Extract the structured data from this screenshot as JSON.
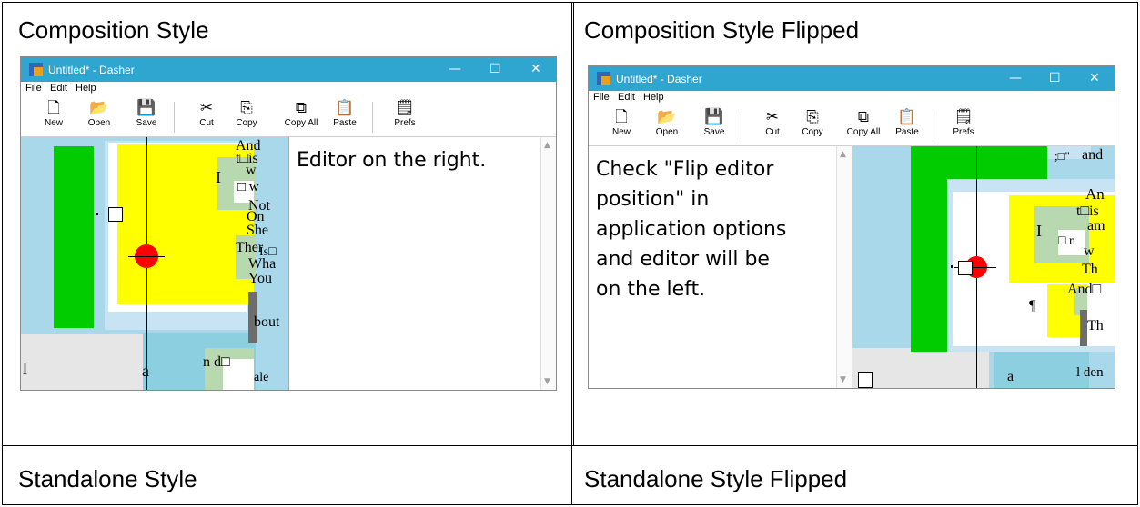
{
  "cells": {
    "top_left_title": "Composition Style",
    "top_right_title": "Composition Style Flipped",
    "bottom_left_title": "Standalone Style",
    "bottom_right_title": "Standalone Style Flipped"
  },
  "window": {
    "title": "Untitled* - Dasher",
    "minimize_glyph": "—",
    "maximize_glyph": "☐",
    "close_glyph": "✕"
  },
  "menu": [
    "File",
    "Edit",
    "Help"
  ],
  "toolbar": {
    "new_label": "New",
    "open_label": "Open",
    "save_label": "Save",
    "cut_label": "Cut",
    "copy_label": "Copy",
    "copy_all_label": "Copy All",
    "paste_label": "Paste",
    "prefs_label": "Prefs"
  },
  "icons": {
    "new": "new-file-icon",
    "open": "open-folder-icon",
    "save": "floppy-save-icon",
    "cut": "scissors-cut-icon",
    "copy": "copy-icon",
    "copy_all": "copy-all-icon",
    "paste": "clipboard-paste-icon",
    "prefs": "preferences-icon"
  },
  "left_editor_text": "Editor on the right.",
  "right_editor_lines": [
    "Check \"Flip editor",
    "position\" in",
    "application options",
    "and  editor will be",
    "on the left."
  ],
  "left_glyphs": {
    "g_and": "And",
    "g_t_is": "t□is",
    "g_w1": "w",
    "g_I": "I",
    "g_box_w": "□ w",
    "g_Not": "Not",
    "g_On": "On",
    "g_She": "She",
    "g_Ther": "Ther",
    "g_Is": "Is□",
    "g_What": "Wha",
    "g_You": "You",
    "g_bout": "bout",
    "g_l": "l",
    "g_a": "a",
    "g_nd": "n  d□",
    "g_ale": "ale"
  },
  "right_glyphs": {
    "g_and": "and",
    "g_quote": ";□\"",
    "g_An": "An",
    "g_t_is": "t□is",
    "g_I": "I",
    "g_am": "am",
    "g_box_n": "□ n",
    "g_w": "w",
    "g_Th1": "Th",
    "g_And": "And□",
    "g_pilcrow": "¶",
    "g_Th2": "Th",
    "g_a": "a",
    "g_l_den": "l den",
    "g_box": "□"
  },
  "colors": {
    "canvas_blue": "#a8d8ea",
    "green": "#00cc00",
    "yellow": "#ffff00",
    "sage": "#b8d8b0",
    "pale_blue": "#c8e4f4",
    "grey": "#e6e6e6",
    "red_cursor": "#ff0000",
    "titlebar": "#2ea6cf"
  }
}
